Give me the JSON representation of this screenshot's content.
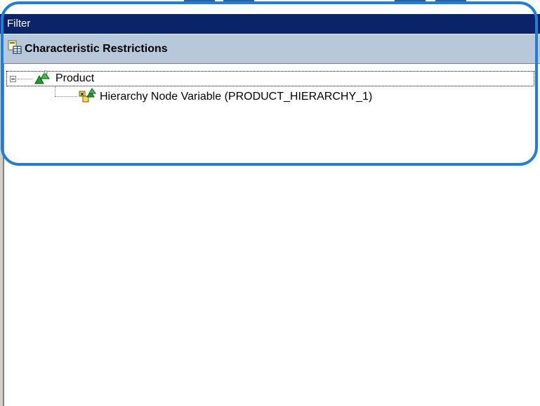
{
  "panel": {
    "title": "Filter",
    "section": {
      "title": "Characteristic Restrictions",
      "icon": "characteristic-restrictions-icon"
    },
    "tree": [
      {
        "label": "Product",
        "icon": "characteristic-hierarchy-icon",
        "expanded": true,
        "children": [
          {
            "label": "Hierarchy Node Variable (PRODUCT_HIERARCHY_1)",
            "icon": "hierarchy-node-variable-icon"
          }
        ]
      }
    ]
  },
  "colors": {
    "title_bar": "#0a246a",
    "section_header": "#b7c8db",
    "highlight": "#1f7fd8"
  }
}
